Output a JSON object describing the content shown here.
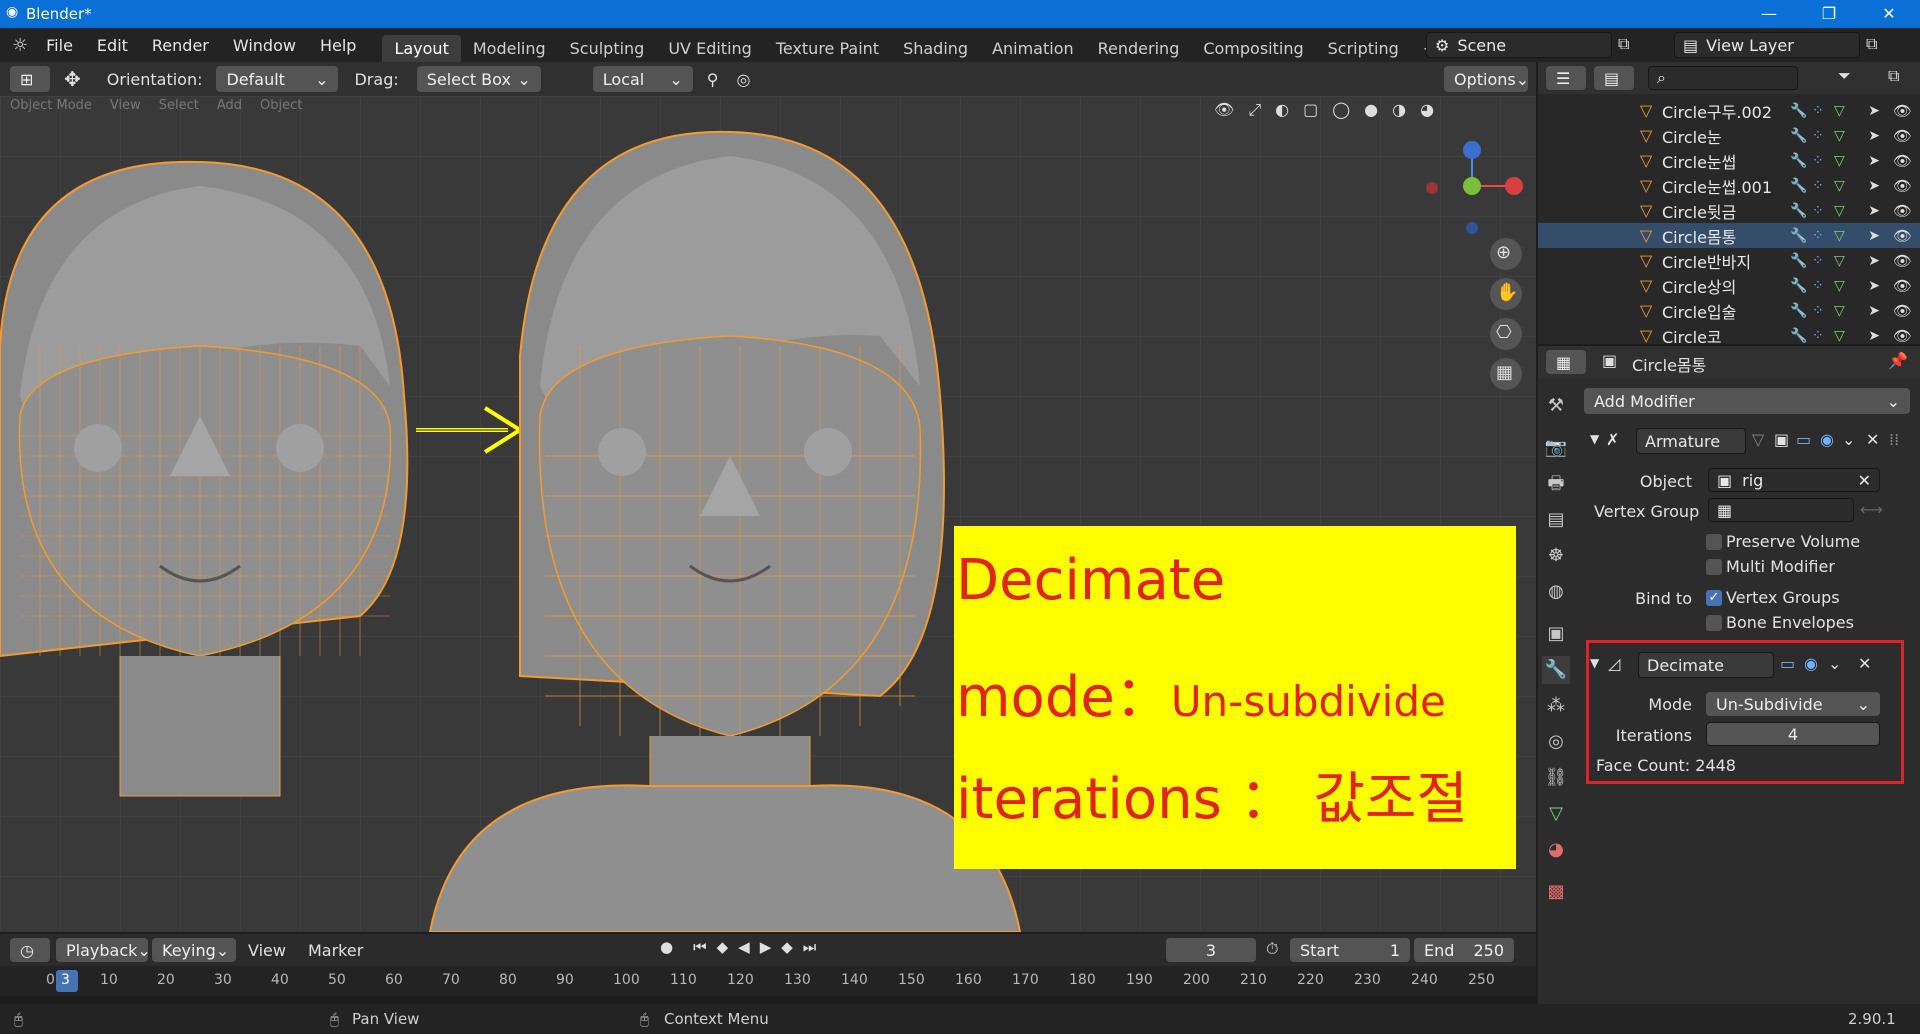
{
  "window": {
    "title": "Blender*",
    "minimize": "—",
    "restore": "❐",
    "close": "✕"
  },
  "menu": [
    "File",
    "Edit",
    "Render",
    "Window",
    "Help"
  ],
  "workspaces": [
    "Layout",
    "Modeling",
    "Sculpting",
    "UV Editing",
    "Texture Paint",
    "Shading",
    "Animation",
    "Rendering",
    "Compositing",
    "Scripting",
    "+"
  ],
  "scene": {
    "name": "Scene",
    "view_layer": "View Layer"
  },
  "toolbar": {
    "orientation_label": "Orientation:",
    "orientation_value": "Default",
    "drag_label": "Drag:",
    "drag_value": "Select Box",
    "pivot_value": "Local",
    "options_label": "Options"
  },
  "viewport_menu": [
    "Object Mode",
    "View",
    "Select",
    "Add",
    "Object"
  ],
  "note": {
    "line1": "Decimate",
    "line2a": "mode：",
    "line2b": "Un-subdivide",
    "line3": "iterations ： 값조절"
  },
  "outliner": {
    "rows": [
      {
        "name": "Circle구두.002",
        "selected": false
      },
      {
        "name": "Circle눈",
        "selected": false
      },
      {
        "name": "Circle눈썹",
        "selected": false
      },
      {
        "name": "Circle눈썹.001",
        "selected": false
      },
      {
        "name": "Circle뒷금",
        "selected": false
      },
      {
        "name": "Circle몸통",
        "selected": true
      },
      {
        "name": "Circle반바지",
        "selected": false
      },
      {
        "name": "Circle상의",
        "selected": false
      },
      {
        "name": "Circle입술",
        "selected": false
      },
      {
        "name": "Circle코",
        "selected": false
      }
    ]
  },
  "properties": {
    "object_name": "Circle몸통",
    "add_modifier": "Add Modifier",
    "armature": {
      "name": "Armature",
      "object_label": "Object",
      "object_value": "rig",
      "vertex_group_label": "Vertex Group",
      "preserve_volume": "Preserve Volume",
      "multi_modifier": "Multi Modifier",
      "bind_to_label": "Bind to",
      "vertex_groups": "Vertex Groups",
      "bone_envelopes": "Bone Envelopes"
    },
    "decimate": {
      "name": "Decimate",
      "mode_label": "Mode",
      "mode_value": "Un-Subdivide",
      "iterations_label": "Iterations",
      "iterations_value": "4",
      "face_count": "Face Count: 2448"
    }
  },
  "timeline": {
    "playback": "Playback",
    "keying": "Keying",
    "view": "View",
    "marker": "Marker",
    "current_frame": "3",
    "start_label": "Start",
    "start_value": "1",
    "end_label": "End",
    "end_value": "250",
    "ticks": [
      "0",
      "10",
      "20",
      "30",
      "40",
      "50",
      "60",
      "70",
      "80",
      "90",
      "100",
      "110",
      "120",
      "130",
      "140",
      "150",
      "160",
      "170",
      "180",
      "190",
      "200",
      "210",
      "220",
      "230",
      "240",
      "250"
    ]
  },
  "status": {
    "pan": "Pan View",
    "context": "Context Menu",
    "version": "2.90.1"
  },
  "colors": {
    "accent": "#4772b3",
    "selection_outline": "#f49a2e",
    "note_bg": "#ffff00",
    "note_text": "#e3221b",
    "highlight_box": "#e0232b"
  }
}
